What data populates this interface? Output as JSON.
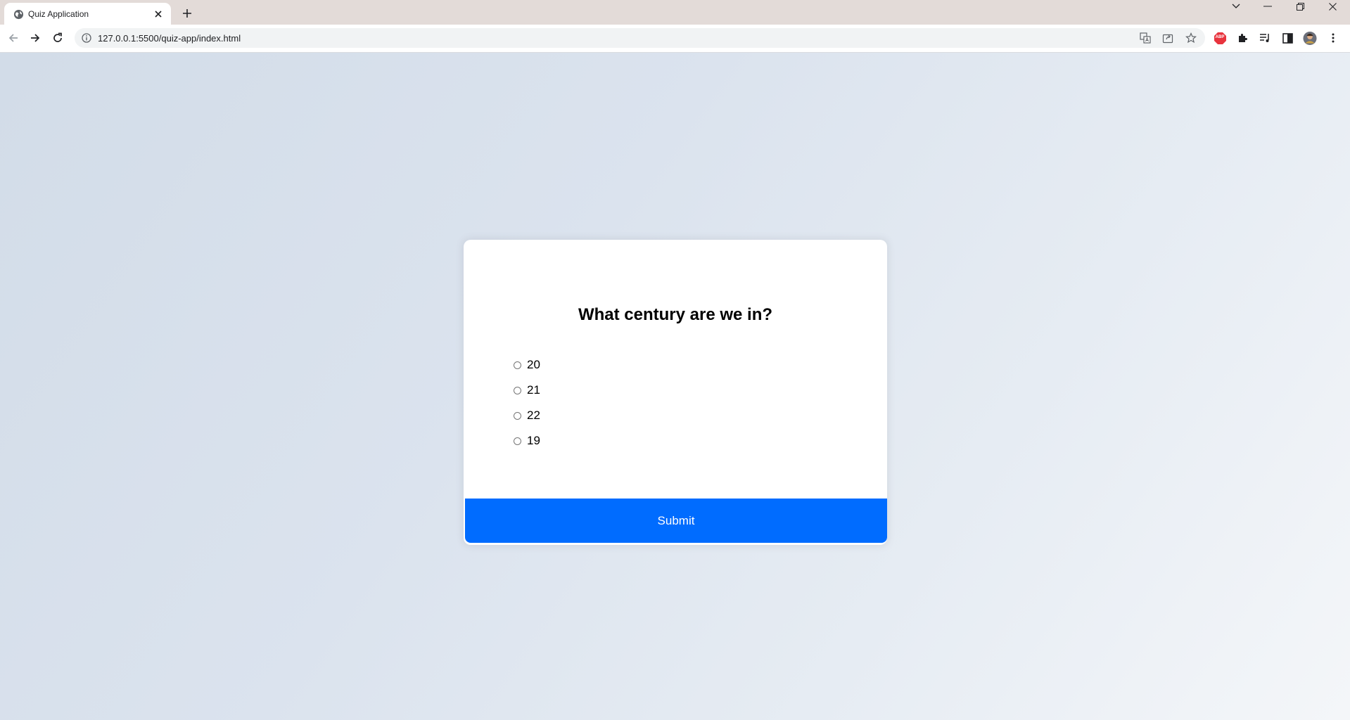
{
  "browser": {
    "tab_title": "Quiz Application",
    "url": "127.0.0.1:5500/quiz-app/index.html",
    "extension_badge": "ABP",
    "icons": {
      "favicon": "globe-icon",
      "tab_close": "close-icon",
      "new_tab": "plus-icon",
      "back": "back-arrow-icon",
      "forward": "forward-arrow-icon",
      "reload": "reload-icon",
      "site_info": "info-icon",
      "translate": "translate-icon",
      "share": "share-icon",
      "bookmark": "star-icon",
      "adblock": "adblock-icon",
      "extensions": "puzzle-icon",
      "media": "media-queue-icon",
      "side_panel": "side-panel-icon",
      "profile": "avatar",
      "menu": "kebab-menu-icon",
      "tab_search": "chevron-down-icon",
      "minimize": "minimize-icon",
      "restore": "restore-icon",
      "close_window": "close-icon"
    }
  },
  "quiz": {
    "question": "What century are we in?",
    "answers": [
      "20",
      "21",
      "22",
      "19"
    ],
    "submit_label": "Submit"
  },
  "colors": {
    "accent": "#006cff",
    "tabstrip": "#e3dbd8",
    "adblock_red": "#e8343e"
  }
}
